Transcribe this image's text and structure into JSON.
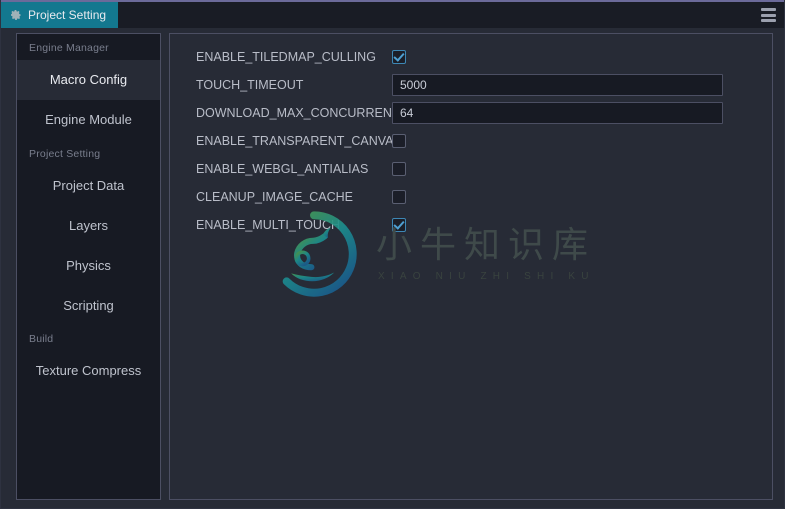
{
  "window": {
    "accent_teal": "#13788f",
    "panel_bg": "#272b36",
    "sunken_bg": "#171a23",
    "border": "#4c4f63"
  },
  "tabbar": {
    "tab_label": "Project Setting",
    "gear_icon": "gear-icon",
    "menu_icon": "hamburger-menu-icon"
  },
  "sidebar": {
    "groups": [
      {
        "header": "Engine Manager",
        "items": [
          {
            "label": "Macro Config",
            "active": true
          },
          {
            "label": "Engine Module",
            "active": false
          }
        ]
      },
      {
        "header": "Project Setting",
        "items": [
          {
            "label": "Project Data",
            "active": false
          },
          {
            "label": "Layers",
            "active": false
          },
          {
            "label": "Physics",
            "active": false
          },
          {
            "label": "Scripting",
            "active": false
          }
        ]
      },
      {
        "header": "Build",
        "items": [
          {
            "label": "Texture Compress",
            "active": false
          }
        ]
      }
    ]
  },
  "settings": {
    "rows": [
      {
        "label": "ENABLE_TILEDMAP_CULLING",
        "type": "checkbox",
        "checked": true
      },
      {
        "label": "TOUCH_TIMEOUT",
        "type": "text",
        "value": "5000",
        "placeholder": ""
      },
      {
        "label": "DOWNLOAD_MAX_CONCURRENT",
        "type": "text",
        "value": "64",
        "placeholder": ""
      },
      {
        "label": "ENABLE_TRANSPARENT_CANVAS",
        "type": "checkbox",
        "checked": false
      },
      {
        "label": "ENABLE_WEBGL_ANTIALIAS",
        "type": "checkbox",
        "checked": false
      },
      {
        "label": "CLEANUP_IMAGE_CACHE",
        "type": "checkbox",
        "checked": false
      },
      {
        "label": "ENABLE_MULTI_TOUCH",
        "type": "checkbox",
        "checked": true
      }
    ]
  },
  "watermark": {
    "chinese": "小牛知识库",
    "pinyin": "XIAO NIU ZHI SHI KU",
    "logo_icon": "ox-circle-logo-icon"
  }
}
